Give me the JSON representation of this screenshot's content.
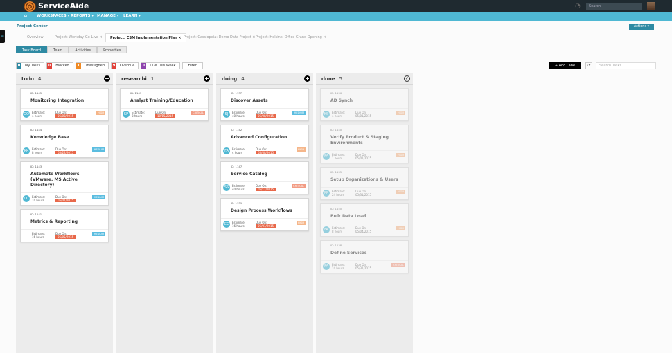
{
  "header": {
    "brand": "ServiceAide",
    "search_placeholder": "Search"
  },
  "nav": [
    "WORKSPACES ▾",
    "REPORTS ▾",
    "MANAGE ▾",
    "LEARN ▾"
  ],
  "breadcrumb": "Project Center",
  "actions_label": "Actions ▾",
  "project_tabs": [
    {
      "label": "Overview",
      "active": false
    },
    {
      "label": "Project: Workday Go-Live ×",
      "active": false
    },
    {
      "label": "Project: CSM Implementation Plan ×",
      "active": true
    },
    {
      "label": "Project: Cassiopeia: Demo Data Project ×",
      "active": false
    },
    {
      "label": "Project: Helsinki Office Grand Opening ×",
      "active": false
    }
  ],
  "sub_tabs": [
    {
      "label": "Task Board",
      "active": true
    },
    {
      "label": "Team"
    },
    {
      "label": "Activities"
    },
    {
      "label": "Properties"
    }
  ],
  "filters": [
    {
      "count": "0",
      "label": "My Tasks",
      "color": "#2e8aa3"
    },
    {
      "count": "0",
      "label": "Blocked",
      "color": "#e2423a"
    },
    {
      "count": "1",
      "label": "Unassigned",
      "color": "#f08a24"
    },
    {
      "count": "9",
      "label": "Overdue",
      "color": "#e2423a"
    },
    {
      "count": "0",
      "label": "Due This Week",
      "color": "#8e44ad"
    }
  ],
  "filter_label": "Filter",
  "add_lane_label": "+ Add Lane",
  "search_tasks_placeholder": "Search Tasks",
  "colors": {
    "medium": "#5bbde0",
    "high": "#f5b68a",
    "critical": "#f29c84",
    "due": "#e8684a"
  },
  "lanes": [
    {
      "name": "todo",
      "count": "4",
      "icon": "plus",
      "cards": [
        {
          "id": "ID: 1145",
          "title": "Monitoring Integration",
          "avatar": "OO",
          "estimate": "4 hours",
          "due": "06/08/2015",
          "priority": "HIGH"
        },
        {
          "id": "ID: 1144",
          "title": "Knowledge Base",
          "avatar": "KK",
          "estimate": "8 hours",
          "due": "05/22/2015",
          "priority": "MEDIUM"
        },
        {
          "id": "ID: 1143",
          "title": "Automate Workflows (VMware, MS Active Directory)",
          "avatar": "CC",
          "estimate": "24 hours",
          "due": "05/01/2015",
          "priority": "MEDIUM"
        },
        {
          "id": "ID: 1141",
          "title": "Metrics & Reporting",
          "avatar": "",
          "estimate": "16 hours",
          "due": "06/05/2015",
          "priority": "MEDIUM"
        }
      ]
    },
    {
      "name": "researchi",
      "count": "1",
      "icon": "plus",
      "cards": [
        {
          "id": "ID: 1149",
          "title": "Analyst Training/Education",
          "avatar": "SP",
          "estimate": "8 hours",
          "due": "10/15/2015",
          "priority": "CRITICAL"
        }
      ]
    },
    {
      "name": "doing",
      "count": "4",
      "icon": "plus",
      "cards": [
        {
          "id": "ID: 1137",
          "title": "Discover Assets",
          "avatar": "SJ",
          "estimate": "40 hours",
          "due": "06/08/2015",
          "priority": "MEDIUM"
        },
        {
          "id": "ID: 1142",
          "title": "Advanced Configuration",
          "avatar": "FA",
          "estimate": "4 hours",
          "due": "05/08/2015",
          "priority": "HIGH"
        },
        {
          "id": "ID: 1147",
          "title": "Service Catalog",
          "avatar": "SS",
          "estimate": "40 hours",
          "due": "05/12/2015",
          "priority": "CRITICAL"
        },
        {
          "id": "ID: 1139",
          "title": "Design Process Workflows",
          "avatar": "CC",
          "estimate": "16 hours",
          "due": "06/01/2015",
          "priority": "HIGH"
        }
      ]
    },
    {
      "name": "done",
      "count": "5",
      "icon": "check",
      "cards": [
        {
          "id": "ID: 1136",
          "title": "AD Synch",
          "avatar": "KS",
          "estimate": "4 hours",
          "due": "05/01/2015",
          "priority": "HIGH"
        },
        {
          "id": "ID: 1140",
          "title": "Verify Product & Staging Environments",
          "avatar": "FA",
          "estimate": "1 hours",
          "due": "05/01/2015",
          "priority": "HIGH"
        },
        {
          "id": "ID: 1135",
          "title": "Setup Organizations & Users",
          "avatar": "PP",
          "estimate": "24 hours",
          "due": "05/31/2015",
          "priority": "HIGH"
        },
        {
          "id": "ID: 1150",
          "title": "Bulk Data Load",
          "avatar": "FA",
          "estimate": "8 hours",
          "due": "05/04/2015",
          "priority": "HIGH"
        },
        {
          "id": "ID: 1138",
          "title": "Define Services",
          "avatar": "FA",
          "estimate": "24 hours",
          "due": "05/31/2015",
          "priority": "CRITICAL"
        }
      ]
    }
  ],
  "labels": {
    "estimate": "Estimate:",
    "due": "Due On:"
  }
}
